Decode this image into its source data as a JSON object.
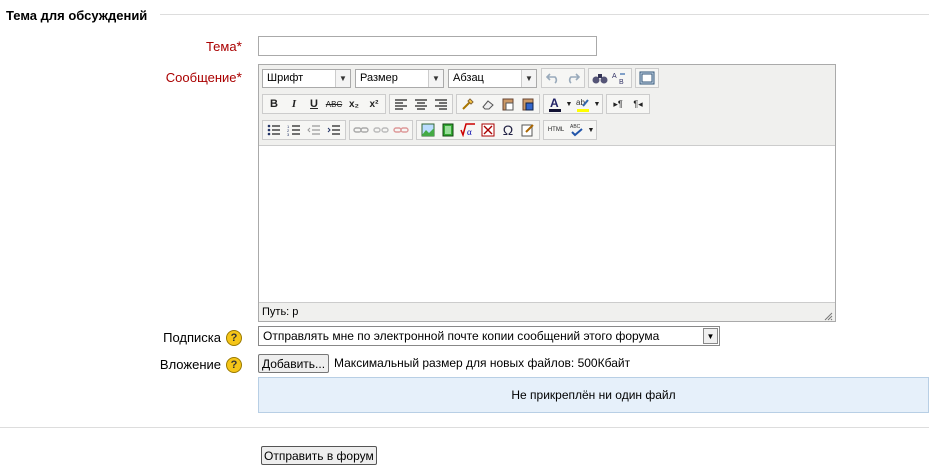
{
  "form": {
    "legend": "Тема для обсуждений",
    "subject_label": "Тема",
    "message_label": "Сообщение",
    "required_mark": "*",
    "subject_value": ""
  },
  "editor": {
    "font_select": "Шрифт",
    "size_select": "Размер",
    "format_select": "Абзац",
    "path_label": "Путь: p",
    "buttons": {
      "bold": "B",
      "italic": "I",
      "underline": "U",
      "strike": "ABC",
      "subscript": "x₂",
      "superscript": "x²",
      "omega": "Ω",
      "html": "HTML",
      "ltr": "▸¶",
      "rtl": "¶◂"
    }
  },
  "subscription": {
    "label": "Подписка",
    "selected": "Отправлять мне по электронной почте копии сообщений этого форума"
  },
  "attachment": {
    "label": "Вложение",
    "add_button": "Добавить...",
    "max_size_text": "Максимальный размер для новых файлов: 500Кбайт",
    "no_file_text": "Не прикреплён ни один файл"
  },
  "help_icon": "?",
  "submit_button": "Отправить в форум"
}
